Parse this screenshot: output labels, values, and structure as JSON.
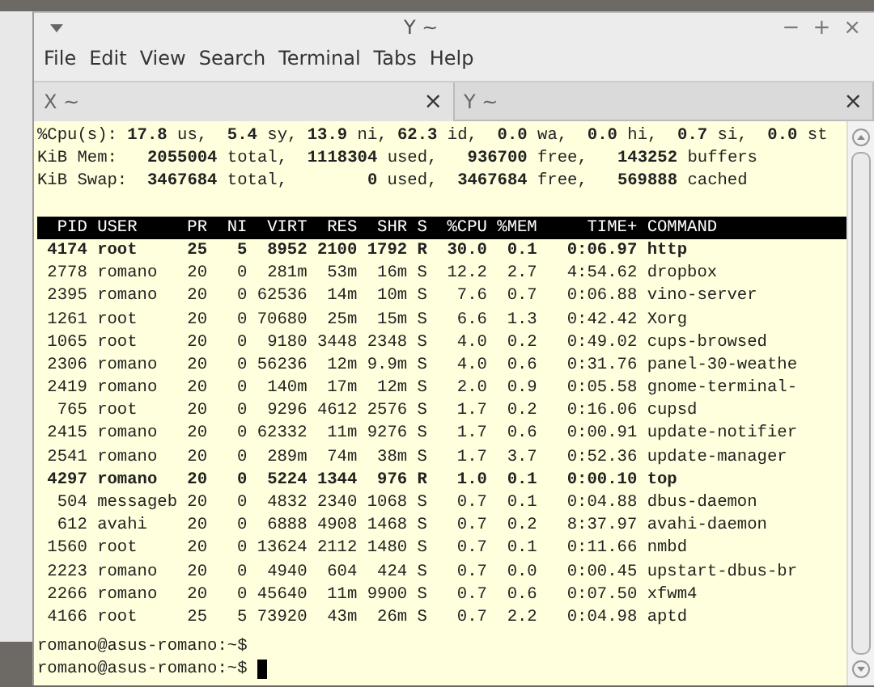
{
  "window": {
    "title": "Y ~",
    "controls": [
      "−",
      "+",
      "×"
    ]
  },
  "menu": [
    "File",
    "Edit",
    "View",
    "Search",
    "Terminal",
    "Tabs",
    "Help"
  ],
  "tabs": [
    {
      "label": "X ~",
      "close": "×",
      "selected": true
    },
    {
      "label": "Y ~",
      "close": "×",
      "selected": false
    }
  ],
  "summary": [
    "%Cpu(s): **17.8** us,  **5.4** sy, **13.9** ni, **62.3** id,  **0.0** wa,  **0.0** hi,  **0.7** si,  **0.0** st",
    "KiB Mem:   **2055004** total,  **1118304** used,   **936700** free,   **143252** buffers",
    "KiB Swap:  **3467684** total,        **0** used,  **3467684** free,   **569888** cached"
  ],
  "table": {
    "columns": [
      "PID",
      "USER",
      "PR",
      "NI",
      "VIRT",
      "RES",
      "SHR",
      "S",
      "%CPU",
      "%MEM",
      "TIME+",
      "COMMAND"
    ],
    "rows": [
      {
        "highlighted": true,
        "cells": [
          "4174",
          "root",
          "25",
          "5",
          "8952",
          "2100",
          "1792",
          "R",
          "30.0",
          "0.1",
          "0:06.97",
          "http"
        ]
      },
      {
        "highlighted": false,
        "cells": [
          "2778",
          "romano",
          "20",
          "0",
          "281m",
          "53m",
          "16m",
          "S",
          "12.2",
          "2.7",
          "4:54.62",
          "dropbox"
        ]
      },
      {
        "highlighted": false,
        "cells": [
          "2395",
          "romano",
          "20",
          "0",
          "62536",
          "14m",
          "10m",
          "S",
          "7.6",
          "0.7",
          "0:06.88",
          "vino-server"
        ]
      },
      {
        "highlighted": false,
        "cells": [
          "1261",
          "root",
          "20",
          "0",
          "70680",
          "25m",
          "15m",
          "S",
          "6.6",
          "1.3",
          "0:42.42",
          "Xorg"
        ]
      },
      {
        "highlighted": false,
        "cells": [
          "1065",
          "root",
          "20",
          "0",
          "9180",
          "3448",
          "2348",
          "S",
          "4.0",
          "0.2",
          "0:49.02",
          "cups-browsed"
        ]
      },
      {
        "highlighted": false,
        "cells": [
          "2306",
          "romano",
          "20",
          "0",
          "56236",
          "12m",
          "9.9m",
          "S",
          "4.0",
          "0.6",
          "0:31.76",
          "panel-30-weathe"
        ]
      },
      {
        "highlighted": false,
        "cells": [
          "2419",
          "romano",
          "20",
          "0",
          "140m",
          "17m",
          "12m",
          "S",
          "2.0",
          "0.9",
          "0:05.58",
          "gnome-terminal-"
        ]
      },
      {
        "highlighted": false,
        "cells": [
          "765",
          "root",
          "20",
          "0",
          "9296",
          "4612",
          "2576",
          "S",
          "1.7",
          "0.2",
          "0:16.06",
          "cupsd"
        ]
      },
      {
        "highlighted": false,
        "cells": [
          "2415",
          "romano",
          "20",
          "0",
          "62332",
          "11m",
          "9276",
          "S",
          "1.7",
          "0.6",
          "0:00.91",
          "update-notifier"
        ]
      },
      {
        "highlighted": false,
        "cells": [
          "2541",
          "romano",
          "20",
          "0",
          "289m",
          "74m",
          "38m",
          "S",
          "1.7",
          "3.7",
          "0:52.36",
          "update-manager"
        ]
      },
      {
        "highlighted": true,
        "cells": [
          "4297",
          "romano",
          "20",
          "0",
          "5224",
          "1344",
          "976",
          "R",
          "1.0",
          "0.1",
          "0:00.10",
          "top"
        ]
      },
      {
        "highlighted": false,
        "cells": [
          "504",
          "messageb",
          "20",
          "0",
          "4832",
          "2340",
          "1068",
          "S",
          "0.7",
          "0.1",
          "0:04.88",
          "dbus-daemon"
        ]
      },
      {
        "highlighted": false,
        "cells": [
          "612",
          "avahi",
          "20",
          "0",
          "6888",
          "4908",
          "1468",
          "S",
          "0.7",
          "0.2",
          "8:37.97",
          "avahi-daemon"
        ]
      },
      {
        "highlighted": false,
        "cells": [
          "1560",
          "root",
          "20",
          "0",
          "13624",
          "2112",
          "1480",
          "S",
          "0.7",
          "0.1",
          "0:11.66",
          "nmbd"
        ]
      },
      {
        "highlighted": false,
        "cells": [
          "2223",
          "romano",
          "20",
          "0",
          "4940",
          "604",
          "424",
          "S",
          "0.7",
          "0.0",
          "0:00.45",
          "upstart-dbus-br"
        ]
      },
      {
        "highlighted": false,
        "cells": [
          "2266",
          "romano",
          "20",
          "0",
          "45640",
          "11m",
          "9900",
          "S",
          "0.7",
          "0.6",
          "0:07.50",
          "xfwm4"
        ]
      },
      {
        "highlighted": false,
        "cells": [
          "4166",
          "root",
          "25",
          "5",
          "73920",
          "43m",
          "26m",
          "S",
          "0.7",
          "2.2",
          "0:04.98",
          "aptd"
        ]
      }
    ]
  },
  "prompts": [
    {
      "text": "romano@asus-romano:~$",
      "cursor": false
    },
    {
      "text": "romano@asus-romano:~$",
      "cursor": true
    }
  ]
}
